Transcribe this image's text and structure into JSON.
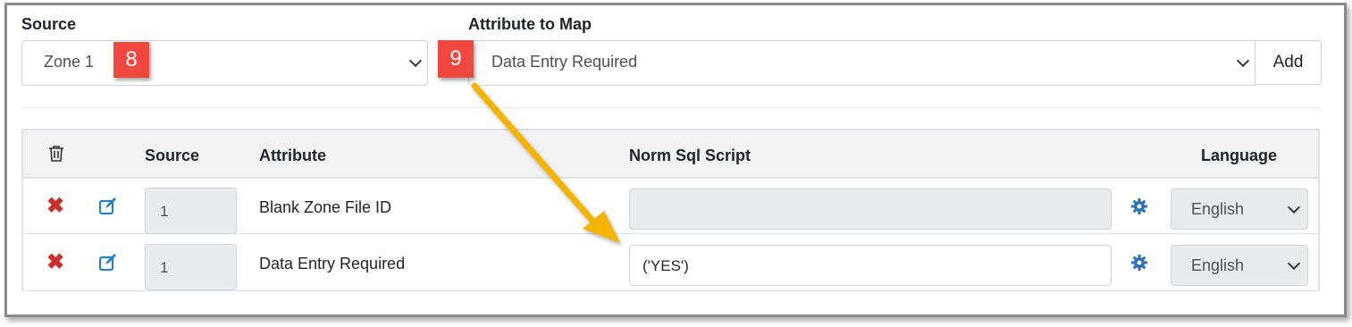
{
  "source": {
    "label": "Source",
    "value": "Zone 1",
    "badge": "8"
  },
  "attribute_to_map": {
    "label": "Attribute to Map",
    "value": "Data Entry Required",
    "badge": "9",
    "add_button": "Add"
  },
  "table": {
    "headers": {
      "source": "Source",
      "attribute": "Attribute",
      "script": "Norm Sql Script",
      "language": "Language"
    },
    "rows": [
      {
        "source": "1",
        "attribute": "Blank Zone File ID",
        "script": "",
        "language": "English"
      },
      {
        "source": "1",
        "attribute": "Data Entry Required",
        "script": "('YES')",
        "language": "English"
      }
    ]
  },
  "colors": {
    "badge": "#f0473f",
    "arrow": "#f5b400",
    "delete": "#c9302c",
    "edit": "#2a80c4",
    "gear": "#2f6fb5"
  }
}
